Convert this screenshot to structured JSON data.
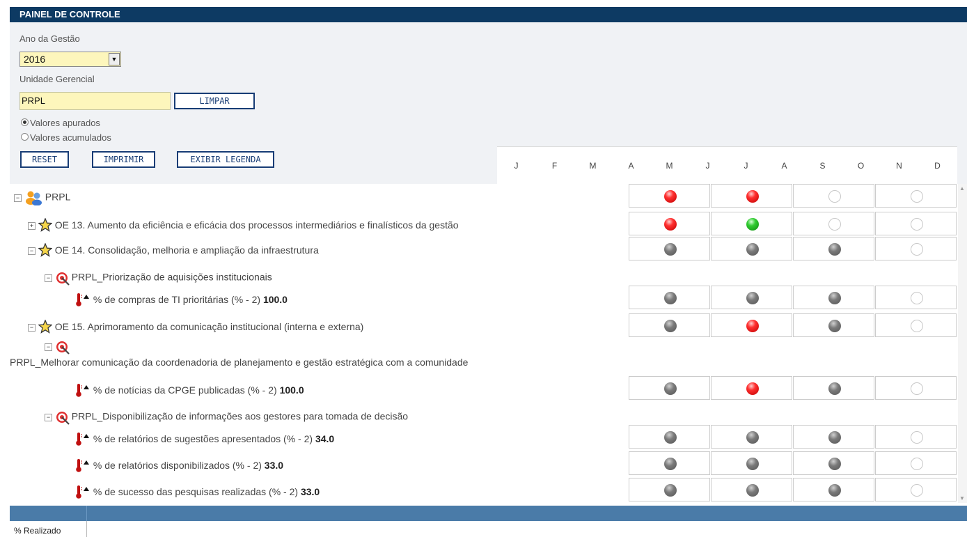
{
  "panel": {
    "title": "PAINEL DE CONTROLE"
  },
  "filters": {
    "year_label": "Ano da Gestão",
    "year_value": "2016",
    "unit_label": "Unidade Gerencial",
    "unit_value": "PRPL",
    "clear_button": "LIMPAR",
    "radio_measured": "Valores apurados",
    "radio_accumulated": "Valores acumulados",
    "selected_radio": "Valores apurados",
    "reset_button": "RESET",
    "print_button": "IMPRIMIR",
    "legend_button": "EXIBIR LEGENDA"
  },
  "months": [
    "J",
    "F",
    "M",
    "A",
    "M",
    "J",
    "J",
    "A",
    "S",
    "O",
    "N",
    "D"
  ],
  "status_colors": {
    "red": "#e01010",
    "green": "#22aa22",
    "gray": "#707070",
    "empty": "#ffffff"
  },
  "rows": [
    {
      "type": "unit",
      "toggle": "⊟",
      "icon": "people-icon",
      "label": "PRPL",
      "value": "",
      "status": [
        "red",
        "red",
        "empty",
        "empty"
      ]
    },
    {
      "type": "objective",
      "toggle": "⊞",
      "icon": "star-icon",
      "label": "OE 13. Aumento da eficiência e eficácia dos processos intermediários e finalísticos da gestão",
      "value": "",
      "status": [
        "red",
        "green",
        "empty",
        "empty"
      ]
    },
    {
      "type": "objective",
      "toggle": "⊟",
      "icon": "star-icon",
      "label": "OE 14. Consolidação, melhoria e ampliação da infraestrutura",
      "value": "",
      "status": [
        "gray",
        "gray",
        "gray",
        "empty"
      ]
    },
    {
      "type": "target",
      "toggle": "⊟",
      "icon": "target-icon",
      "label": "PRPL_Priorização de aquisições institucionais",
      "value": "",
      "status": []
    },
    {
      "type": "indicator",
      "toggle": "",
      "icon": "thermometer-icon",
      "label": "% de compras de TI prioritárias (% - 2)",
      "value": "100.0",
      "status": [
        "gray",
        "gray",
        "gray",
        "empty"
      ]
    },
    {
      "type": "objective",
      "toggle": "⊟",
      "icon": "star-icon",
      "label": "OE 15. Aprimoramento da comunicação institucional (interna e externa)",
      "value": "",
      "status": [
        "gray",
        "red",
        "gray",
        "empty"
      ]
    },
    {
      "type": "target",
      "toggle": "⊟",
      "icon": "target-icon",
      "label": "PRPL_Melhorar comunicação da coordenadoria de planejamento e gestão estratégica com a comunidade",
      "value": "",
      "status": []
    },
    {
      "type": "indicator",
      "toggle": "",
      "icon": "thermometer-icon",
      "label": "% de notícias da CPGE publicadas (% - 2)",
      "value": "100.0",
      "status": [
        "gray",
        "red",
        "gray",
        "empty"
      ]
    },
    {
      "type": "target",
      "toggle": "⊟",
      "icon": "target-icon",
      "label": "PRPL_Disponibilização de informações aos gestores para tomada de decisão",
      "value": "",
      "status": []
    },
    {
      "type": "indicator",
      "toggle": "",
      "icon": "thermometer-icon",
      "label": "% de relatórios de sugestões apresentados (% - 2)",
      "value": "34.0",
      "status": [
        "gray",
        "gray",
        "gray",
        "empty"
      ]
    },
    {
      "type": "indicator",
      "toggle": "",
      "icon": "thermometer-icon",
      "label": "% de relatórios disponibilizados (% - 2)",
      "value": "33.0",
      "status": [
        "gray",
        "gray",
        "gray",
        "empty"
      ]
    },
    {
      "type": "indicator",
      "toggle": "",
      "icon": "thermometer-icon",
      "label": "% de sucesso das pesquisas realizadas (% - 2)",
      "value": "33.0",
      "status": [
        "gray",
        "gray",
        "gray",
        "empty"
      ]
    }
  ],
  "footer": {
    "label": "% Realizado"
  }
}
